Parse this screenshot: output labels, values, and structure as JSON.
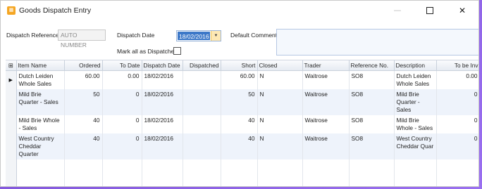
{
  "window": {
    "title": "Goods Dispatch Entry",
    "icon": "app-icon",
    "minimize": "—",
    "close": "✕"
  },
  "form": {
    "dispatch_reference_label": "Dispatch Reference",
    "dispatch_reference_value": "AUTO NUMBER",
    "dispatch_date_label": "Dispatch Date",
    "dispatch_date_value": "18/02/2016",
    "default_comments_label": "Default Comments",
    "default_comments_value": "",
    "mark_all_label": "Mark all as Dispatched",
    "mark_all_checked": false
  },
  "grid": {
    "columns": [
      "Item Name",
      "Ordered",
      "To Date",
      "Dispatch Date",
      "Dispatched",
      "Short",
      "Closed",
      "Trader",
      "Reference No.",
      "Description",
      "To be Inv"
    ],
    "rows": [
      {
        "item_name": "Dutch Leiden Whole Sales",
        "ordered": "60.00",
        "to_date": "0.00",
        "dispatch_date": "18/02/2016",
        "dispatched": "",
        "short": "60.00",
        "closed": "N",
        "trader": "Waitrose",
        "reference_no": "SO8",
        "description": "Dutch Leiden Whole Sales",
        "to_be_inv": "0.00"
      },
      {
        "item_name": "Mild Brie Quarter - Sales",
        "ordered": "50",
        "to_date": "0",
        "dispatch_date": "18/02/2016",
        "dispatched": "",
        "short": "50",
        "closed": "N",
        "trader": "Waitrose",
        "reference_no": "SO8",
        "description": "Mild Brie Quarter - Sales",
        "to_be_inv": "0"
      },
      {
        "item_name": "Mild Brie Whole - Sales",
        "ordered": "40",
        "to_date": "0",
        "dispatch_date": "18/02/2016",
        "dispatched": "",
        "short": "40",
        "closed": "N",
        "trader": "Waitrose",
        "reference_no": "SO8",
        "description": "Mild Brie Whole - Sales",
        "to_be_inv": "0"
      },
      {
        "item_name": "West Country Cheddar Quarter",
        "ordered": "40",
        "to_date": "0",
        "dispatch_date": "18/02/2016",
        "dispatched": "",
        "short": "40",
        "closed": "N",
        "trader": "Waitrose",
        "reference_no": "SO8",
        "description": "West Country Cheddar Quar",
        "to_be_inv": "0"
      }
    ]
  }
}
